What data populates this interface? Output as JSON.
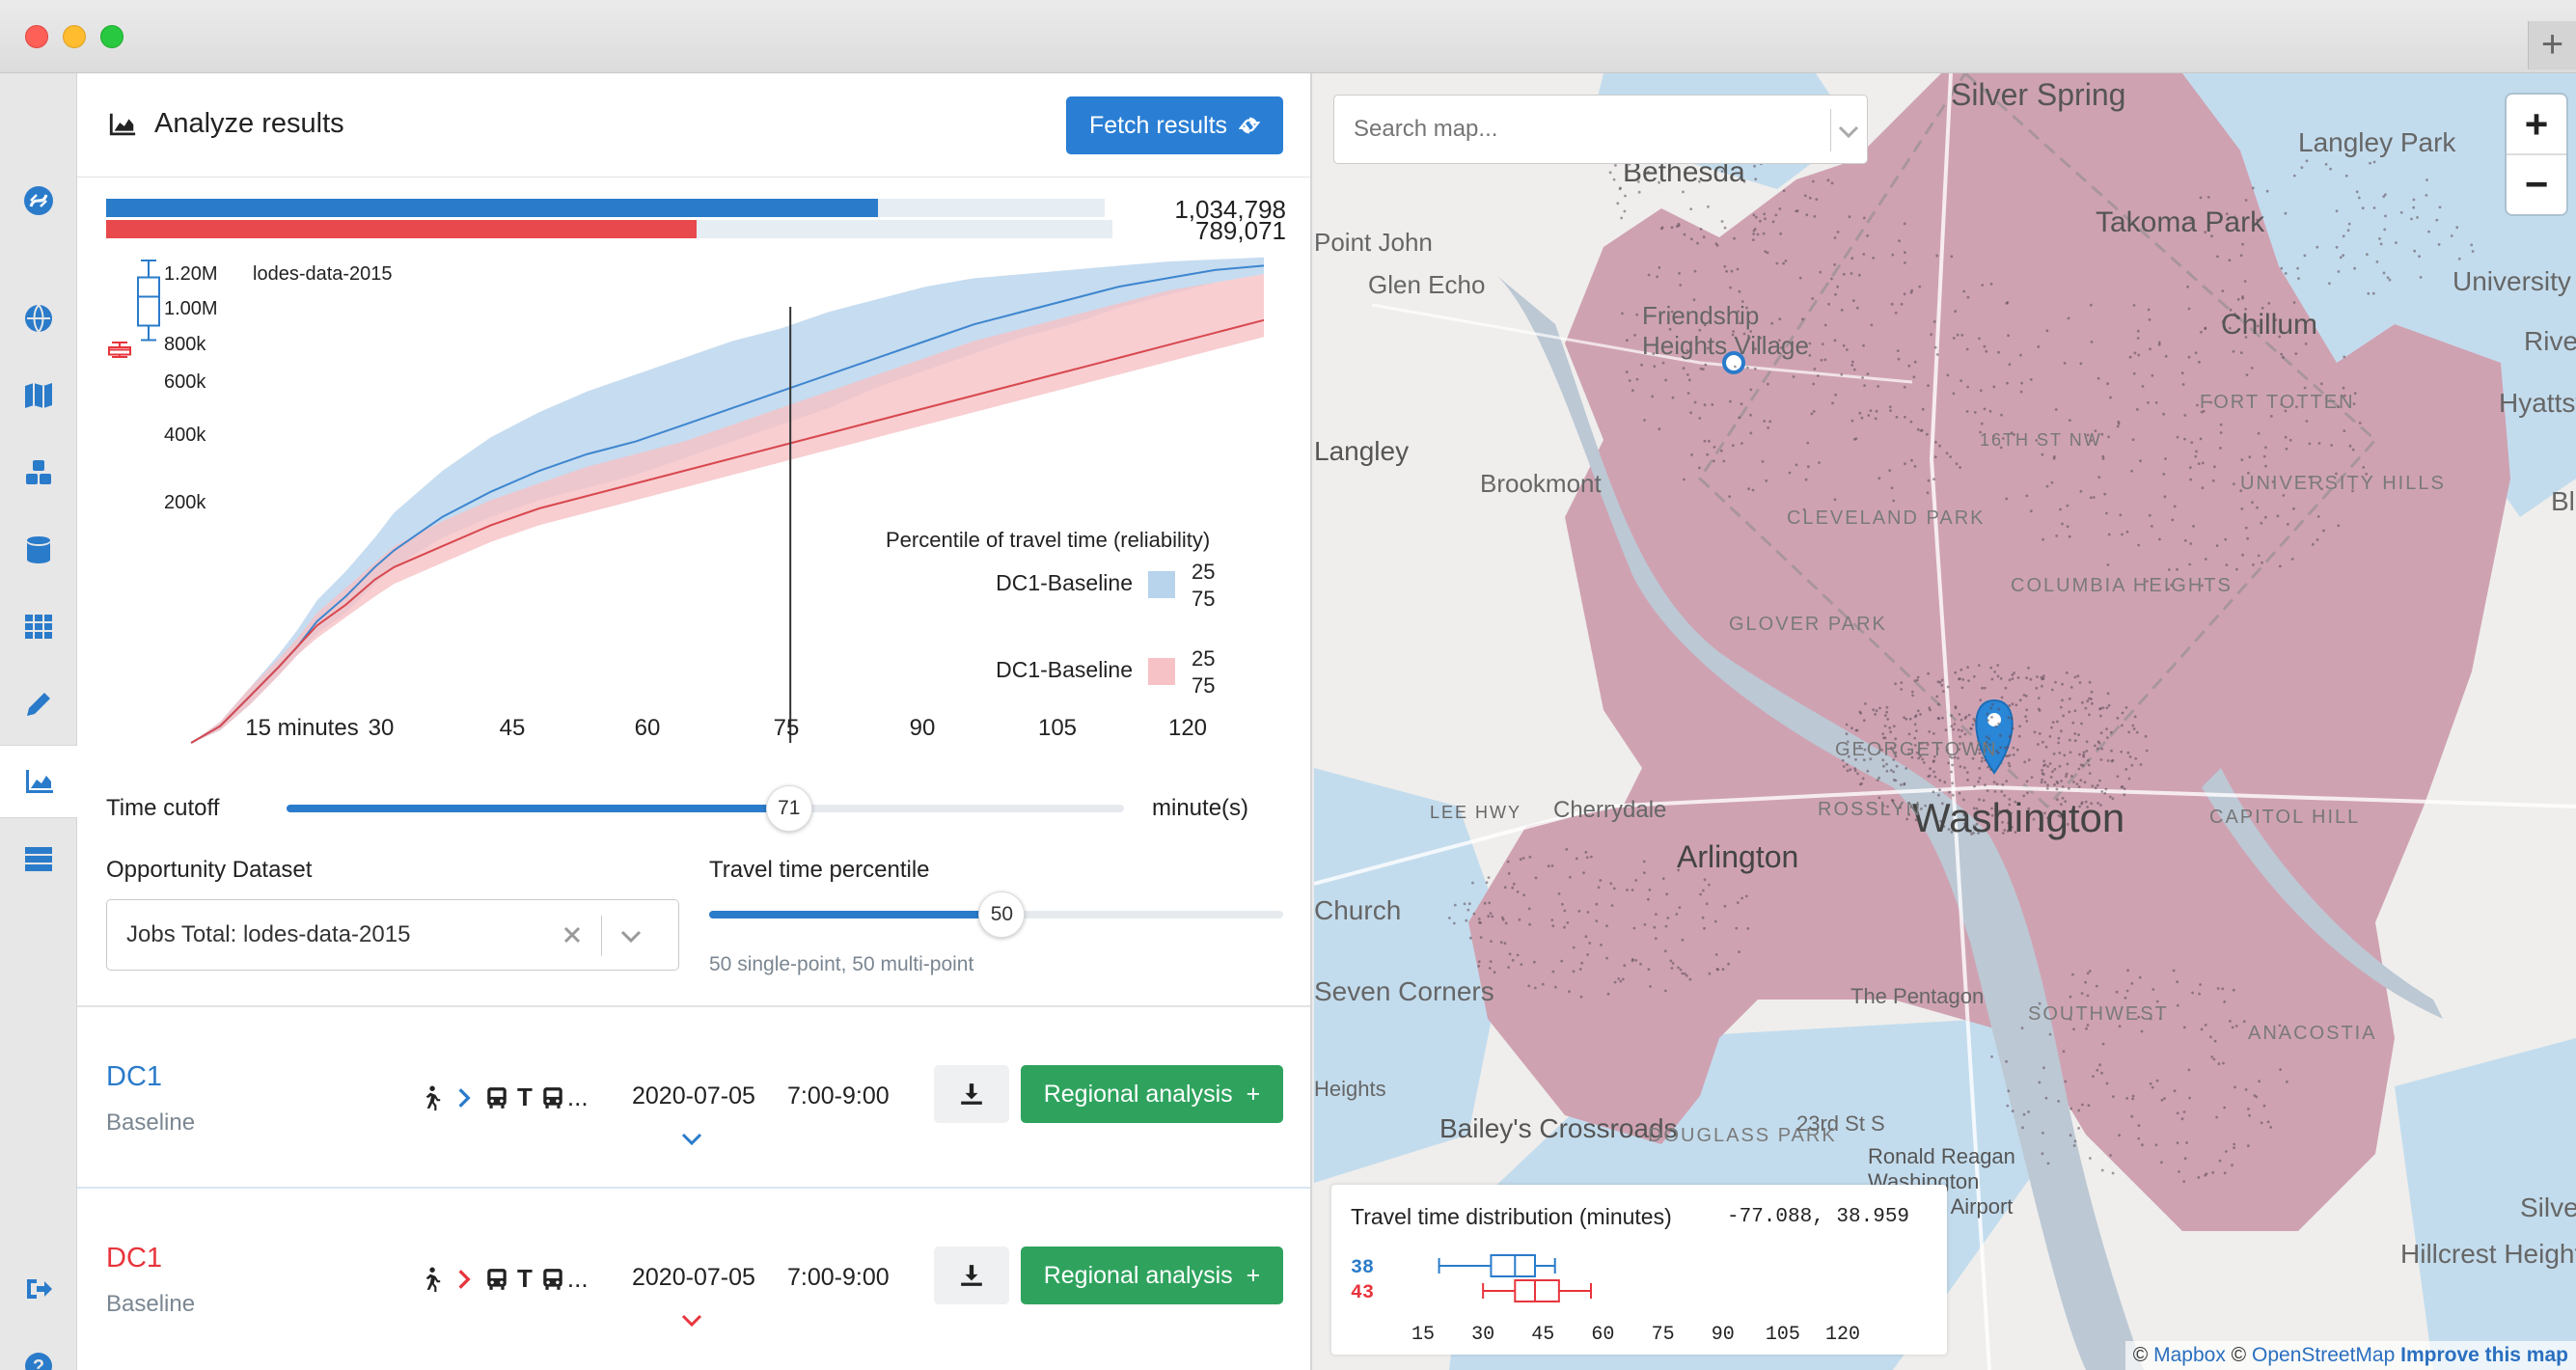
{
  "window": {
    "new_tab_label": "+"
  },
  "sidebar": {
    "items": [
      "logo-icon",
      "regions-globe-icon",
      "map-icon",
      "cubes-icon",
      "database-icon",
      "grid-icon",
      "pencil-icon",
      "chart-area-icon",
      "server-icon",
      "sign-out-icon",
      "help-icon"
    ],
    "active": "chart-area-icon"
  },
  "panel": {
    "title": "Analyze results",
    "fetch_button": "Fetch results",
    "access_bars": [
      {
        "value": 1034798,
        "label": "1,034,798",
        "fraction": 0.75,
        "color": "#2a7bca"
      },
      {
        "value": 789071,
        "label": "789,071",
        "fraction": 0.57,
        "color": "#e8494c"
      }
    ],
    "box_legend_label": "lodes-data-2015",
    "time_cutoff": {
      "label": "Time cutoff",
      "value": "71",
      "unit": "minute(s)",
      "fraction": 0.6
    },
    "opportunity": {
      "label": "Opportunity Dataset",
      "value": "Jobs Total: lodes-data-2015"
    },
    "percentile": {
      "label": "Travel time percentile",
      "value": "50",
      "fraction": 0.51,
      "hint": "50 single-point, 50 multi-point"
    },
    "rows": [
      {
        "name": "DC1",
        "sub": "Baseline",
        "color": "#2a7bca",
        "modes_more": "...",
        "transit_letter": "T",
        "date": "2020-07-05",
        "time": "7:00-9:00",
        "analysis_button": "Regional analysis",
        "plus": "+"
      },
      {
        "name": "DC1",
        "sub": "Baseline",
        "color": "#e8343c",
        "modes_more": "...",
        "transit_letter": "T",
        "date": "2020-07-05",
        "time": "7:00-9:00",
        "analysis_button": "Regional analysis",
        "plus": "+"
      }
    ]
  },
  "chart_data": {
    "type": "area",
    "title": "",
    "xlabel": "",
    "ylabel": "",
    "x_ticks": [
      "15 minutes",
      "30",
      "45",
      "60",
      "75",
      "90",
      "105",
      "120"
    ],
    "x_tick_values": [
      15,
      30,
      45,
      60,
      75,
      90,
      105,
      120
    ],
    "y_ticks": [
      "1.20M",
      "1.00M",
      "800k",
      "600k",
      "400k",
      "200k"
    ],
    "y_tick_values": [
      1200000,
      1000000,
      800000,
      600000,
      400000,
      200000
    ],
    "xlim": [
      0,
      120
    ],
    "ylim": [
      0,
      1300000
    ],
    "cutoff_line_x": 71,
    "legend": {
      "title": "Percentile of travel time (reliability)",
      "entries": [
        {
          "name": "DC1-Baseline",
          "color": "#b8d3ec",
          "p_low": "25",
          "p_high": "75"
        },
        {
          "name": "DC1-Baseline",
          "color": "#f6c2c6",
          "p_low": "25",
          "p_high": "75"
        }
      ]
    },
    "series": [
      {
        "name": "DC1-Baseline",
        "color": "#3d86cf",
        "band": "#b8d3ec",
        "x": [
          9,
          12,
          15,
          18,
          20,
          22,
          25,
          28,
          30,
          35,
          40,
          45,
          50,
          55,
          60,
          65,
          70,
          75,
          80,
          85,
          90,
          95,
          100,
          105,
          110,
          115,
          120
        ],
        "median": [
          0,
          40000,
          110000,
          180000,
          230000,
          290000,
          350000,
          420000,
          460000,
          540000,
          600000,
          650000,
          690000,
          720000,
          760000,
          800000,
          840000,
          880000,
          920000,
          960000,
          1000000,
          1030000,
          1060000,
          1090000,
          1110000,
          1130000,
          1140000
        ],
        "low": [
          0,
          30000,
          90000,
          160000,
          210000,
          260000,
          310000,
          380000,
          420000,
          490000,
          540000,
          580000,
          610000,
          640000,
          680000,
          720000,
          760000,
          800000,
          850000,
          890000,
          930000,
          970000,
          1000000,
          1040000,
          1070000,
          1100000,
          1120000
        ],
        "high": [
          0,
          50000,
          130000,
          210000,
          270000,
          340000,
          410000,
          490000,
          550000,
          650000,
          730000,
          790000,
          840000,
          880000,
          920000,
          960000,
          990000,
          1030000,
          1060000,
          1090000,
          1110000,
          1120000,
          1130000,
          1140000,
          1150000,
          1155000,
          1160000
        ]
      },
      {
        "name": "DC1-Baseline",
        "color": "#d8484f",
        "band": "#f6c2c6",
        "x": [
          9,
          12,
          15,
          18,
          20,
          22,
          25,
          28,
          30,
          35,
          40,
          45,
          50,
          55,
          60,
          65,
          70,
          75,
          80,
          85,
          90,
          95,
          100,
          105,
          110,
          115,
          120
        ],
        "median": [
          0,
          40000,
          110000,
          180000,
          230000,
          280000,
          330000,
          390000,
          420000,
          470000,
          520000,
          560000,
          590000,
          620000,
          650000,
          680000,
          710000,
          740000,
          770000,
          800000,
          830000,
          860000,
          890000,
          920000,
          950000,
          980000,
          1010000
        ],
        "low": [
          0,
          30000,
          90000,
          160000,
          210000,
          250000,
          300000,
          350000,
          380000,
          430000,
          480000,
          520000,
          550000,
          580000,
          610000,
          640000,
          670000,
          700000,
          730000,
          760000,
          790000,
          820000,
          850000,
          880000,
          910000,
          940000,
          970000
        ],
        "high": [
          0,
          50000,
          130000,
          200000,
          250000,
          310000,
          370000,
          430000,
          470000,
          530000,
          580000,
          620000,
          660000,
          690000,
          720000,
          760000,
          800000,
          840000,
          880000,
          920000,
          960000,
          990000,
          1020000,
          1050000,
          1080000,
          1100000,
          1120000
        ]
      }
    ],
    "boxplots": [
      {
        "color": "#2a7bca",
        "min": 830000,
        "q1": 890000,
        "median": 1010000,
        "q3": 1090000,
        "max": 1160000
      },
      {
        "color": "#e8343c",
        "min": 760000,
        "q1": 770000,
        "median": 790000,
        "q3": 800000,
        "max": 820000
      }
    ]
  },
  "map": {
    "search_placeholder": "Search map...",
    "zoom_in": "+",
    "zoom_out": "−",
    "places": [
      "Silver Spring",
      "Langley Park",
      "Bethesda",
      "Takoma Park",
      "Chillum",
      "University",
      "Riverdale",
      "Hyattsville",
      "Bladensburg",
      "Glen Echo",
      "Friendship Heights Village",
      "Langley",
      "Brookmont",
      "Cleveland Park",
      "Columbia Heights",
      "Glover Park",
      "Fort Totten",
      "University Hills",
      "16th St NW",
      "Washington",
      "Arlington",
      "Cherrydale",
      "Lee Hwy",
      "Rosslyn",
      "Georgetown",
      "Capitol Hill",
      "The Pentagon",
      "Southwest",
      "Anacostia",
      "Bailey's Crossroads",
      "Douglass Park",
      "23rd St S",
      "Ronald Reagan Washington National Airport",
      "Hillcrest Heights",
      "Silver Hill",
      "Church",
      "Seven Corners",
      "Heights",
      "Point John"
    ],
    "distribution": {
      "title": "Travel time distribution (minutes)",
      "coords": "-77.088, 38.959",
      "rows": [
        {
          "label": "38",
          "color": "#2a7bca",
          "min": 19,
          "q1": 32,
          "median": 38,
          "q3": 43,
          "max": 48
        },
        {
          "label": "43",
          "color": "#e8343c",
          "min": 30,
          "q1": 38,
          "median": 43,
          "q3": 49,
          "max": 57
        }
      ],
      "ticks": [
        "15",
        "30",
        "45",
        "60",
        "75",
        "90",
        "105",
        "120"
      ],
      "tick_values": [
        15,
        30,
        45,
        60,
        75,
        90,
        105,
        120
      ]
    },
    "attribution": {
      "copy1": "©",
      "mapbox": "Mapbox",
      "copy2": "©",
      "osm": "OpenStreetMap",
      "improve": "Improve this map"
    }
  }
}
